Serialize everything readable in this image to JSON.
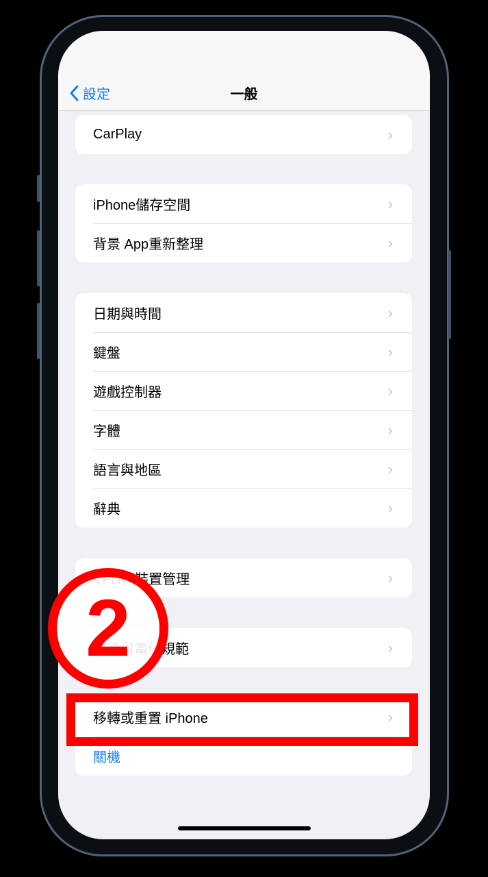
{
  "nav": {
    "back_label": "設定",
    "title": "一般"
  },
  "groups": [
    {
      "items": [
        {
          "label": "CarPlay"
        }
      ]
    },
    {
      "items": [
        {
          "label": "iPhone儲存空間"
        },
        {
          "label": "背景 App重新整理"
        }
      ]
    },
    {
      "items": [
        {
          "label": "日期與時間"
        },
        {
          "label": "鍵盤"
        },
        {
          "label": "遊戲控制器"
        },
        {
          "label": "字體"
        },
        {
          "label": "語言與地區"
        },
        {
          "label": "辭典"
        }
      ]
    },
    {
      "items": [
        {
          "label": "VPN與裝置管理"
        }
      ]
    },
    {
      "items": [
        {
          "label": "法律與電信規範"
        }
      ]
    },
    {
      "items": [
        {
          "label": "移轉或重置 iPhone"
        },
        {
          "label": "關機"
        }
      ]
    }
  ],
  "annotation": {
    "step": "2",
    "color": "#ff0000"
  },
  "colors": {
    "accent": "#1a7cf5",
    "background": "#f0f0f5"
  }
}
